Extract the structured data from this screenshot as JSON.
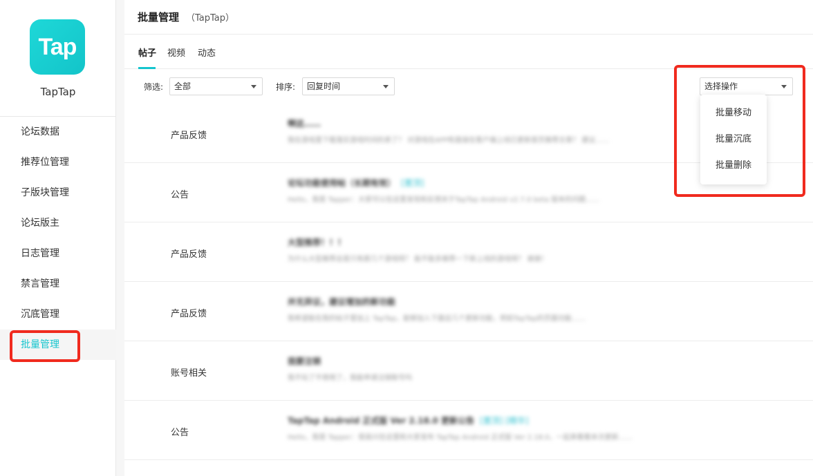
{
  "sidebar": {
    "logo_text": "Tap",
    "app_name": "TapTap",
    "items": [
      {
        "label": "论坛数据"
      },
      {
        "label": "推荐位管理"
      },
      {
        "label": "子版块管理"
      },
      {
        "label": "论坛版主"
      },
      {
        "label": "日志管理"
      },
      {
        "label": "禁言管理"
      },
      {
        "label": "沉底管理"
      },
      {
        "label": "批量管理",
        "active": true
      }
    ]
  },
  "header": {
    "title": "批量管理",
    "subtitle": "（TapTap）"
  },
  "tabs": [
    {
      "label": "帖子",
      "active": true
    },
    {
      "label": "视频"
    },
    {
      "label": "动态"
    }
  ],
  "filters": {
    "filter_label": "筛选:",
    "filter_value": "全部",
    "sort_label": "排序:",
    "sort_value": "回复时间",
    "action_value": "选择操作"
  },
  "action_menu": {
    "items": [
      {
        "label": "批量移动"
      },
      {
        "label": "批量沉底"
      },
      {
        "label": "批量删除"
      }
    ]
  },
  "posts": [
    {
      "category": "产品反馈",
      "title": "啊这……",
      "desc": "我在游戏里下载落实游戏时间的表了？ 对游戏在APP和直接在客户端上线已更新首页推荐文章？ 建议……"
    },
    {
      "category": "公告",
      "title": "论坛功能使用帖（长期有效）",
      "tag": "[置顶]",
      "desc": "Hello，我是 Tapper：大家可以在这里发现和反馈关于TapTap Android v2.7.0 beta 版本的问题……"
    },
    {
      "category": "产品反馈",
      "title": "大型推荐！！！",
      "desc": "为什么大型推荐总是只有那几个游戏呀？ 能不能多推荐一下新上线的游戏呀？ 谢谢！"
    },
    {
      "category": "产品反馈",
      "title": "并无异议，建议增加的新功能",
      "desc": "我希望能在我的帖子里加上 TapTap，能够加入下面这几个更新功能，例如TapTap的页面功能……"
    },
    {
      "category": "账号相关",
      "title": "我要注销",
      "desc": "我不玩了不想用了，我能申请注销账号吗"
    },
    {
      "category": "公告",
      "title": "TapTap Android 正式版 Ver 2.18.0 更新公告",
      "tag": "[置顶] [精华]",
      "desc": "Hello，我是 Tapper：很高兴在这里和大家发布 TapTap Android 正式版 Ver 2.18.0，一起来看看本次更新……"
    }
  ]
}
